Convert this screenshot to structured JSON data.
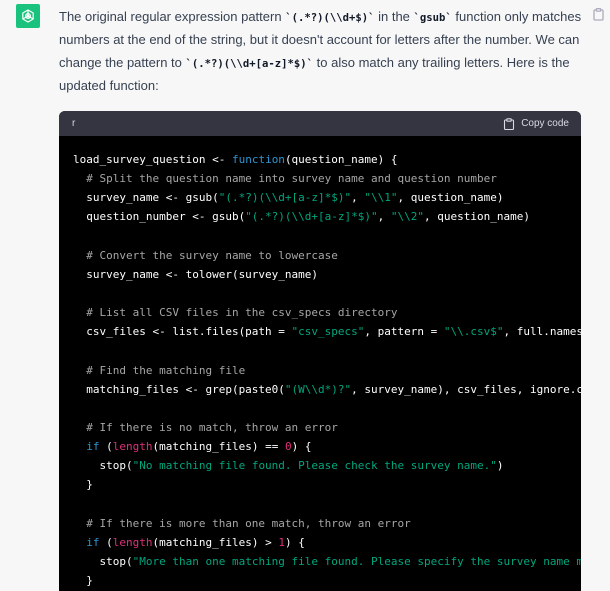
{
  "message": {
    "p1_a": "The original regular expression pattern ",
    "p1_code1": "`(.*?)(\\\\d+$)`",
    "p1_b": " in the ",
    "p1_code2": "`gsub`",
    "p1_c": " function only matches numbers at the end of the string, but it doesn't account for letters after the number. We can change the pattern to ",
    "p1_code3": "`(.*?)(\\\\d+[a-z]*$)`",
    "p1_d": " to also match any trailing letters. Here is the updated function:"
  },
  "code_block": {
    "language": "r",
    "copy_label": "Copy code",
    "lines": [
      [
        {
          "t": "p",
          "v": "load_survey_question <- "
        },
        {
          "t": "fn",
          "v": "function"
        },
        {
          "t": "p",
          "v": "(question_name) {"
        }
      ],
      [
        {
          "t": "cm",
          "v": "  # Split the question name into survey name and question number"
        }
      ],
      [
        {
          "t": "p",
          "v": "  survey_name <- gsub("
        },
        {
          "t": "str",
          "v": "\"(.*?)(\\\\d+[a-z]*$)\""
        },
        {
          "t": "p",
          "v": ", "
        },
        {
          "t": "str",
          "v": "\"\\\\1\""
        },
        {
          "t": "p",
          "v": ", question_name)"
        }
      ],
      [
        {
          "t": "p",
          "v": "  question_number <- gsub("
        },
        {
          "t": "str",
          "v": "\"(.*?)(\\\\d+[a-z]*$)\""
        },
        {
          "t": "p",
          "v": ", "
        },
        {
          "t": "str",
          "v": "\"\\\\2\""
        },
        {
          "t": "p",
          "v": ", question_name)"
        }
      ],
      [],
      [
        {
          "t": "cm",
          "v": "  # Convert the survey name to lowercase"
        }
      ],
      [
        {
          "t": "p",
          "v": "  survey_name <- tolower(survey_name)"
        }
      ],
      [],
      [
        {
          "t": "cm",
          "v": "  # List all CSV files in the csv_specs directory"
        }
      ],
      [
        {
          "t": "p",
          "v": "  csv_files <- list.files(path = "
        },
        {
          "t": "str",
          "v": "\"csv_specs\""
        },
        {
          "t": "p",
          "v": ", pattern = "
        },
        {
          "t": "str",
          "v": "\"\\\\.csv$\""
        },
        {
          "t": "p",
          "v": ", full.names = TRUE)"
        }
      ],
      [],
      [
        {
          "t": "cm",
          "v": "  # Find the matching file"
        }
      ],
      [
        {
          "t": "p",
          "v": "  matching_files <- grep(paste0("
        },
        {
          "t": "str",
          "v": "\"(W\\\\d*)?\""
        },
        {
          "t": "p",
          "v": ", survey_name), csv_files, ignore.case = TRUE, value = TRUE)"
        }
      ],
      [],
      [
        {
          "t": "cm",
          "v": "  # If there is no match, throw an error"
        }
      ],
      [
        {
          "t": "p",
          "v": "  "
        },
        {
          "t": "fn",
          "v": "if"
        },
        {
          "t": "p",
          "v": " ("
        },
        {
          "t": "num",
          "v": "length"
        },
        {
          "t": "p",
          "v": "(matching_files) == "
        },
        {
          "t": "num",
          "v": "0"
        },
        {
          "t": "p",
          "v": ") {"
        }
      ],
      [
        {
          "t": "p",
          "v": "    stop("
        },
        {
          "t": "str",
          "v": "\"No matching file found. Please check the survey name.\""
        },
        {
          "t": "p",
          "v": ")"
        }
      ],
      [
        {
          "t": "p",
          "v": "  }"
        }
      ],
      [],
      [
        {
          "t": "cm",
          "v": "  # If there is more than one match, throw an error"
        }
      ],
      [
        {
          "t": "p",
          "v": "  "
        },
        {
          "t": "fn",
          "v": "if"
        },
        {
          "t": "p",
          "v": " ("
        },
        {
          "t": "num",
          "v": "length"
        },
        {
          "t": "p",
          "v": "(matching_files) > "
        },
        {
          "t": "num",
          "v": "1"
        },
        {
          "t": "p",
          "v": ") {"
        }
      ],
      [
        {
          "t": "p",
          "v": "    stop("
        },
        {
          "t": "str",
          "v": "\"More than one matching file found. Please specify the survey name more precisely.\""
        },
        {
          "t": "p",
          "v": ")"
        }
      ],
      [
        {
          "t": "p",
          "v": "  }"
        }
      ]
    ]
  },
  "colors": {
    "avatar_bg": "#19c37d",
    "code_bg": "#000000",
    "code_header_bg": "#343541",
    "keyword": "#2e95d3",
    "string": "#00a67d",
    "comment": "#a6a6a6",
    "number": "#df3079"
  },
  "icons": {
    "avatar": "openai-logo-icon",
    "copy_message": "clipboard-icon",
    "copy_code": "clipboard-icon"
  }
}
